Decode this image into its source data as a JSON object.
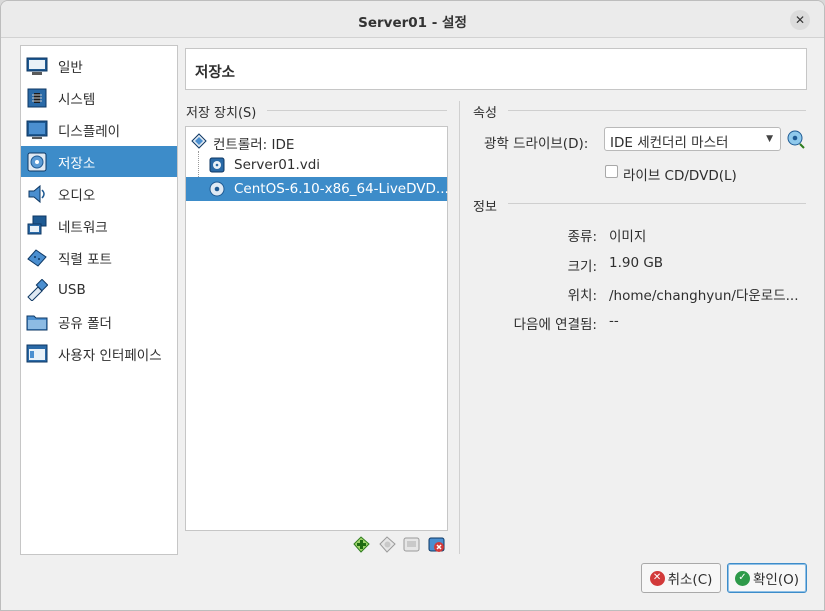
{
  "window": {
    "title": "Server01 - 설정",
    "close_glyph": "✕"
  },
  "sidebar": {
    "items": [
      {
        "label": "일반",
        "icon": "monitor-icon"
      },
      {
        "label": "시스템",
        "icon": "chip-icon"
      },
      {
        "label": "디스플레이",
        "icon": "display-icon"
      },
      {
        "label": "저장소",
        "icon": "storage-disk-icon",
        "selected": true
      },
      {
        "label": "오디오",
        "icon": "speaker-icon"
      },
      {
        "label": "네트워크",
        "icon": "network-icon"
      },
      {
        "label": "직렬 포트",
        "icon": "serial-port-icon"
      },
      {
        "label": "USB",
        "icon": "usb-icon"
      },
      {
        "label": "공유 폴더",
        "icon": "folder-icon"
      },
      {
        "label": "사용자 인터페이스",
        "icon": "user-interface-icon"
      }
    ]
  },
  "page": {
    "title": "저장소"
  },
  "storage": {
    "section_label": "저장 장치(S)",
    "controller": "컨트롤러: IDE",
    "devices": [
      {
        "label": "Server01.vdi",
        "icon": "hard-disk-icon",
        "selected": false
      },
      {
        "label": "CentOS-6.10-x86_64-LiveDVD...",
        "icon": "optical-disc-icon",
        "selected": true
      }
    ],
    "toolbar": [
      "add-controller-icon",
      "add-attachment-icon",
      "remove-attachment-icon",
      "remove-controller-icon"
    ]
  },
  "attributes": {
    "section_label": "속성",
    "drive_label": "광학 드라이브(D):",
    "drive_value": "IDE 세컨더리 마스터",
    "live_cd_label": "라이브 CD/DVD(L)",
    "live_cd_checked": false
  },
  "info": {
    "section_label": "정보",
    "rows": [
      {
        "label": "종류:",
        "value": "이미지"
      },
      {
        "label": "크기:",
        "value": "1.90 GB"
      },
      {
        "label": "위치:",
        "value": "/home/changhyun/다운로드..."
      },
      {
        "label": "다음에 연결됨:",
        "value": "--"
      }
    ]
  },
  "buttons": {
    "cancel": "취소(C)",
    "ok": "확인(O)"
  },
  "colors": {
    "selection": "#3d8cc9",
    "cancel_icon": "#d23a3a",
    "ok_icon": "#2e9a4a"
  }
}
